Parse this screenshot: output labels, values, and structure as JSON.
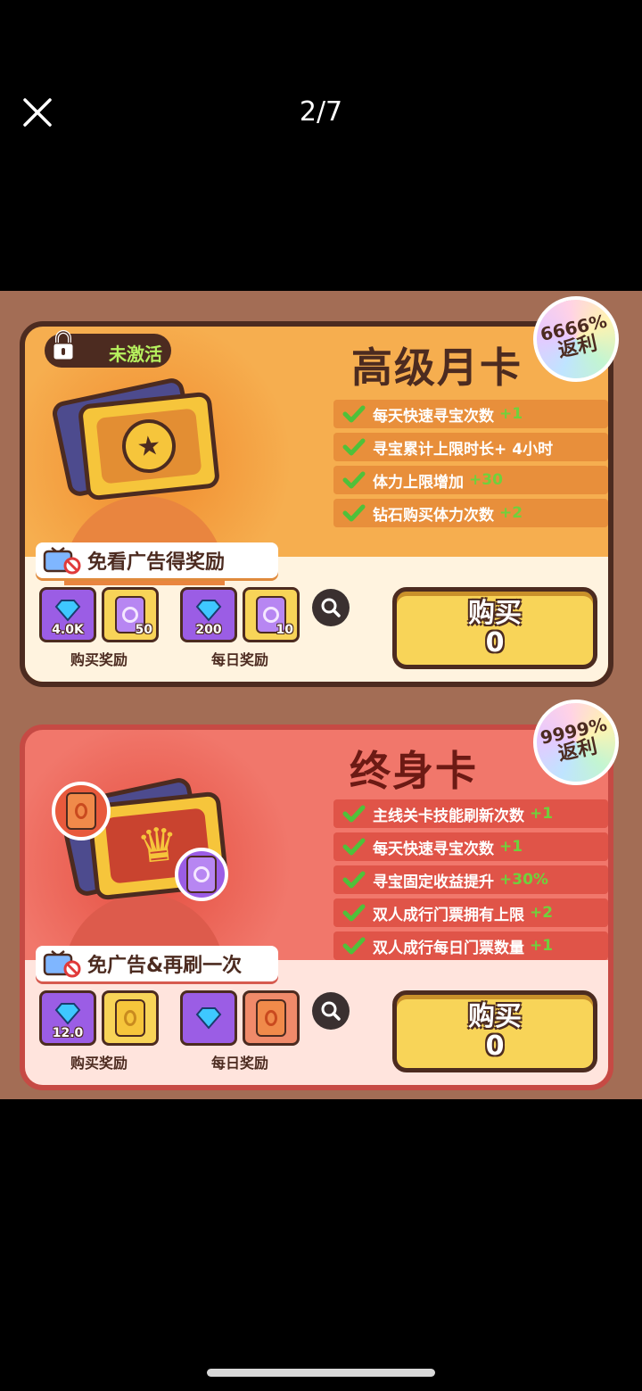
{
  "viewer": {
    "counter": "2/7"
  },
  "cards": [
    {
      "id": "monthly",
      "title": "高级月卡",
      "status": "未激活",
      "rebate": {
        "value": "6666%",
        "label": "返利"
      },
      "perks": [
        {
          "text": "每天快速寻宝次数",
          "bonus": "+1"
        },
        {
          "text": "寻宝累计上限时长+",
          "bonus": "4小时"
        },
        {
          "text": "体力上限增加",
          "bonus": "+30"
        },
        {
          "text": "钻石购买体力次数",
          "bonus": "+2"
        }
      ],
      "ad_text": "免看广告得奖励",
      "purchase_rewards": {
        "label": "购买奖励",
        "items": [
          {
            "icon": "diamond-icon",
            "amount": "4.0K"
          },
          {
            "icon": "swirl-card-icon",
            "amount": "50"
          }
        ]
      },
      "daily_rewards": {
        "label": "每日奖励",
        "items": [
          {
            "icon": "diamond-icon",
            "amount": "200"
          },
          {
            "icon": "swirl-card-icon",
            "amount": "10"
          }
        ]
      },
      "buy": {
        "label": "购买",
        "price": "0"
      }
    },
    {
      "id": "lifetime",
      "title": "终身卡",
      "rebate": {
        "value": "9999%",
        "label": "返利"
      },
      "perks": [
        {
          "text": "主线关卡技能刷新次数",
          "bonus": "+1"
        },
        {
          "text": "每天快速寻宝次数",
          "bonus": "+1"
        },
        {
          "text": "寻宝固定收益提升",
          "bonus": "+30%"
        },
        {
          "text": "双人成行门票拥有上限",
          "bonus": "+2"
        },
        {
          "text": "双人成行每日门票数量",
          "bonus": "+1"
        }
      ],
      "ad_text": "免广告&再刷一次",
      "purchase_rewards": {
        "label": "购买奖励",
        "items": [
          {
            "icon": "diamond-icon",
            "amount": "12.0"
          },
          {
            "icon": "gold-card-icon",
            "amount": ""
          }
        ]
      },
      "daily_rewards": {
        "label": "每日奖励",
        "items": [
          {
            "icon": "diamond-icon",
            "amount": ""
          },
          {
            "icon": "orange-card-icon",
            "amount": ""
          }
        ]
      },
      "buy": {
        "label": "购买",
        "price": "0"
      }
    }
  ],
  "colors": {
    "gold_card": "#f6ae4f",
    "red_card": "#f1776b",
    "outline": "#4c2b20",
    "button": "#f8d458",
    "bonus_green": "#6fd13c"
  }
}
